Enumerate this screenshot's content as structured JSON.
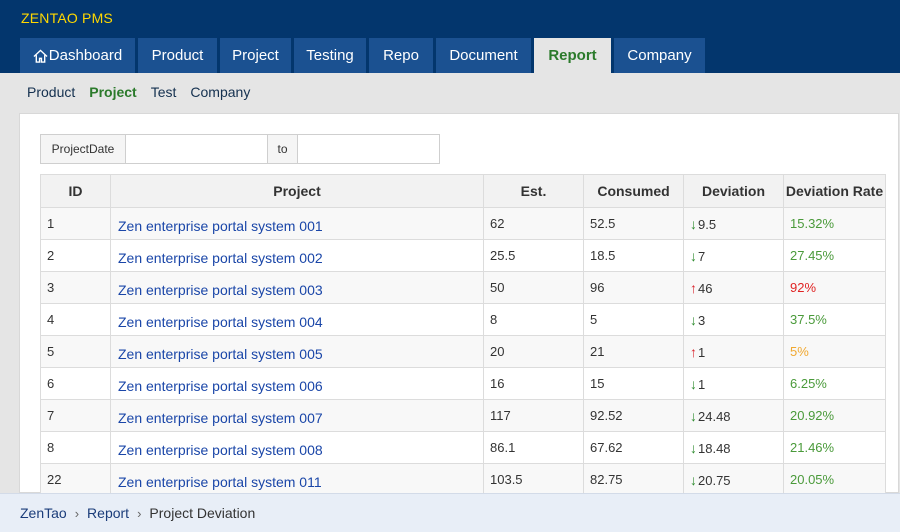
{
  "header": {
    "brand": "ZENTAO PMS",
    "tabs": [
      {
        "label": "Dashboard",
        "icon": "home-icon"
      },
      {
        "label": "Product"
      },
      {
        "label": "Project"
      },
      {
        "label": "Testing"
      },
      {
        "label": "Repo"
      },
      {
        "label": "Document"
      },
      {
        "label": "Report",
        "active": true
      },
      {
        "label": "Company"
      }
    ]
  },
  "subnav": {
    "items": [
      {
        "label": "Product"
      },
      {
        "label": "Project",
        "active": true
      },
      {
        "label": "Test"
      },
      {
        "label": "Company"
      }
    ]
  },
  "filter": {
    "date_label": "ProjectDate",
    "start_value": "",
    "to_label": "to",
    "end_value": ""
  },
  "table": {
    "columns": [
      "ID",
      "Project",
      "Est.",
      "Consumed",
      "Deviation",
      "Deviation Rate"
    ],
    "rows": [
      {
        "id": "1",
        "project": "Zen enterprise portal system 001",
        "est": "62",
        "consumed": "52.5",
        "direction": "down",
        "deviation": "9.5",
        "rate": "15.32%",
        "rate_color": "green"
      },
      {
        "id": "2",
        "project": "Zen enterprise portal system 002",
        "est": "25.5",
        "consumed": "18.5",
        "direction": "down",
        "deviation": "7",
        "rate": "27.45%",
        "rate_color": "green"
      },
      {
        "id": "3",
        "project": "Zen enterprise portal system 003",
        "est": "50",
        "consumed": "96",
        "direction": "up",
        "deviation": "46",
        "rate": "92%",
        "rate_color": "red"
      },
      {
        "id": "4",
        "project": "Zen enterprise portal system 004",
        "est": "8",
        "consumed": "5",
        "direction": "down",
        "deviation": "3",
        "rate": "37.5%",
        "rate_color": "green"
      },
      {
        "id": "5",
        "project": "Zen enterprise portal system 005",
        "est": "20",
        "consumed": "21",
        "direction": "up",
        "deviation": "1",
        "rate": "5%",
        "rate_color": "orange"
      },
      {
        "id": "6",
        "project": "Zen enterprise portal system 006",
        "est": "16",
        "consumed": "15",
        "direction": "down",
        "deviation": "1",
        "rate": "6.25%",
        "rate_color": "green"
      },
      {
        "id": "7",
        "project": "Zen enterprise portal system 007",
        "est": "117",
        "consumed": "92.52",
        "direction": "down",
        "deviation": "24.48",
        "rate": "20.92%",
        "rate_color": "green"
      },
      {
        "id": "8",
        "project": "Zen enterprise portal system 008",
        "est": "86.1",
        "consumed": "67.62",
        "direction": "down",
        "deviation": "18.48",
        "rate": "21.46%",
        "rate_color": "green"
      },
      {
        "id": "22",
        "project": "Zen enterprise portal system 011",
        "est": "103.5",
        "consumed": "82.75",
        "direction": "down",
        "deviation": "20.75",
        "rate": "20.05%",
        "rate_color": "green"
      }
    ]
  },
  "breadcrumb": {
    "items": [
      "ZenTao",
      "Report"
    ],
    "current": "Project Deviation"
  },
  "colors": {
    "header_bg": "#03366d",
    "tab_bg": "#1b5191",
    "brand": "#ffd800",
    "active_green": "#2b7a2b",
    "link_blue": "#1a46a8",
    "arrow_down": "#2e8b2e",
    "arrow_up": "#d9242d",
    "rate_green": "#4a9a3a",
    "rate_red": "#e02424",
    "rate_orange": "#f0a830"
  }
}
